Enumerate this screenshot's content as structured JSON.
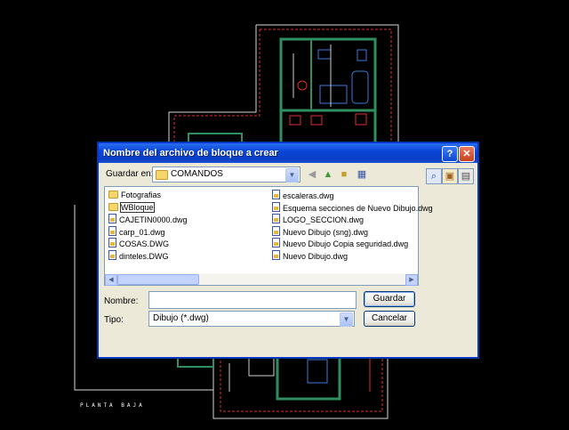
{
  "dialog": {
    "title": "Nombre del archivo de bloque a crear",
    "help_label": "?",
    "close_label": "✕",
    "look_in_label": "Guardar en:",
    "look_in_value": "COMANDOS",
    "filename_label": "Nombre:",
    "filename_value": "",
    "filetype_label": "Tipo:",
    "filetype_value": "Dibujo (*.dwg)",
    "save_label": "Guardar",
    "cancel_label": "Cancelar"
  },
  "files_left": [
    {
      "name": "Fotografias",
      "kind": "folder"
    },
    {
      "name": "WBloque",
      "kind": "folder"
    },
    {
      "name": "CAJETIN0000.dwg",
      "kind": "dwg"
    },
    {
      "name": "carp_01.dwg",
      "kind": "dwg"
    },
    {
      "name": "COSAS.DWG",
      "kind": "dwg"
    },
    {
      "name": "dinteles.DWG",
      "kind": "dwg"
    }
  ],
  "files_right": [
    {
      "name": "escaleras.dwg",
      "kind": "dwg"
    },
    {
      "name": "Esquema secciones de Nuevo Dibujo.dwg",
      "kind": "dwg"
    },
    {
      "name": "LOGO_SECCION.dwg",
      "kind": "dwg"
    },
    {
      "name": "Nuevo Dibujo (sng).dwg",
      "kind": "dwg"
    },
    {
      "name": "Nuevo Dibujo Copia seguridad.dwg",
      "kind": "dwg"
    },
    {
      "name": "Nuevo Dibujo.dwg",
      "kind": "dwg"
    }
  ],
  "background": {
    "plan_label": "PLANTA BAJA"
  }
}
